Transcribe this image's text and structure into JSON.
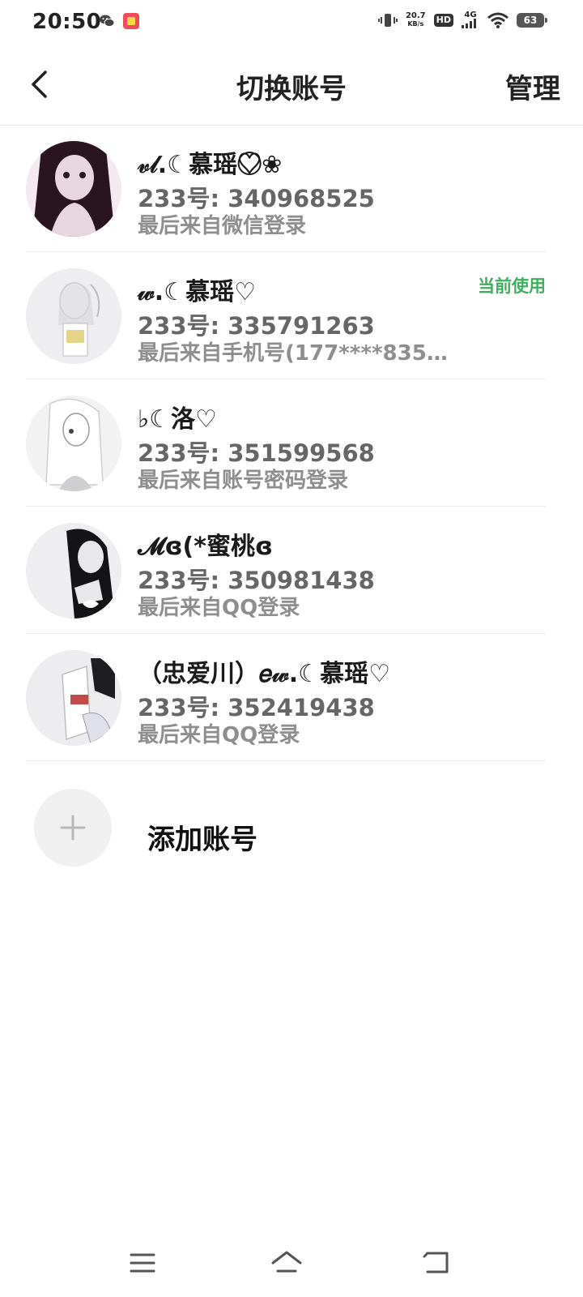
{
  "status_bar": {
    "time": "20:50",
    "net_speed_value": "20.7",
    "net_speed_unit": "KB/s",
    "hd_label": "HD",
    "network_label": "4G",
    "battery_level": "63"
  },
  "header": {
    "title": "切换账号",
    "manage_label": "管理"
  },
  "accounts": [
    {
      "name": "𝓋𝓁.☾慕瑶♡⃝❀",
      "id_text": "233号: 340968525",
      "login_text": "最后来自微信登录",
      "current": false,
      "avatar_colors": [
        "#2a1420",
        "#e8d6df",
        "#f4e9ef"
      ]
    },
    {
      "name": "𝓌.☾慕瑶♡",
      "id_text": "233号: 335791263",
      "login_text": "最后来自手机号(177****835…",
      "current": true,
      "current_label": "当前使用",
      "avatar_colors": [
        "#eeeef0",
        "#c9c9cc",
        "#e6d38a"
      ]
    },
    {
      "name": "♭☾洛♡",
      "id_text": "233号: 351599568",
      "login_text": "最后来自账号密码登录",
      "current": false,
      "avatar_colors": [
        "#f2f2f3",
        "#cfcfd2",
        "#9a9a9f"
      ]
    },
    {
      "name": "𝓜ɞ(*蜜桃ɞ",
      "id_text": "233号: 350981438",
      "login_text": "最后来自QQ登录",
      "current": false,
      "avatar_colors": [
        "#eeeef0",
        "#141416",
        "#e8e8ea"
      ]
    },
    {
      "name": "（忠爱川）𝑒𝓌.☾慕瑶♡",
      "id_text": "233号: 352419438",
      "login_text": "最后来自QQ登录",
      "current": false,
      "avatar_colors": [
        "#ededef",
        "#1e1e22",
        "#c44a4a"
      ]
    }
  ],
  "add_account": {
    "label": "添加账号"
  },
  "colors": {
    "accent_green": "#3fae5f",
    "text_primary": "#1a1a1a",
    "text_secondary": "#666666",
    "text_tertiary": "#8e8e8e"
  }
}
